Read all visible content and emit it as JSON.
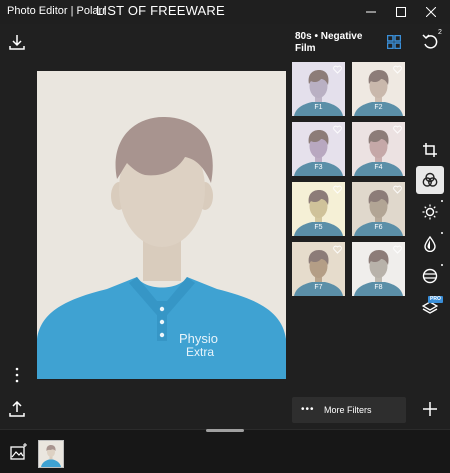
{
  "window": {
    "app_title": "Photo Editor | Polarr",
    "overlay_title": "LIST OF FREEWARE"
  },
  "editor": {
    "filter_pack_title": "80s • Negative Film",
    "undo_badge": "2",
    "more_filters_label": "More Filters",
    "more_icon": "ellipsis-icon",
    "pro_badge": "PRO"
  },
  "photo": {
    "shirt_text_line1": "Physio",
    "shirt_text_line2": "Extra"
  },
  "filters": [
    {
      "label": "F1",
      "tint": "#b9b0c3",
      "bg": "#e4e0ec"
    },
    {
      "label": "F2",
      "tint": "#c9b8ac",
      "bg": "#efe9e2"
    },
    {
      "label": "F3",
      "tint": "#b8a8c0",
      "bg": "#e6e1ec"
    },
    {
      "label": "F4",
      "tint": "#c5a8a8",
      "bg": "#ece2e2"
    },
    {
      "label": "F5",
      "tint": "#cfc29a",
      "bg": "#f5f0d6"
    },
    {
      "label": "F6",
      "tint": "#b2a595",
      "bg": "#e0d8cc"
    },
    {
      "label": "F7",
      "tint": "#b49e86",
      "bg": "#e6dccc"
    },
    {
      "label": "F8",
      "tint": "#b8b2aa",
      "bg": "#f0eeec"
    }
  ],
  "colors": {
    "accent": "#3a8fd9",
    "shirt": "#3fa2d2",
    "background": "#202020"
  }
}
